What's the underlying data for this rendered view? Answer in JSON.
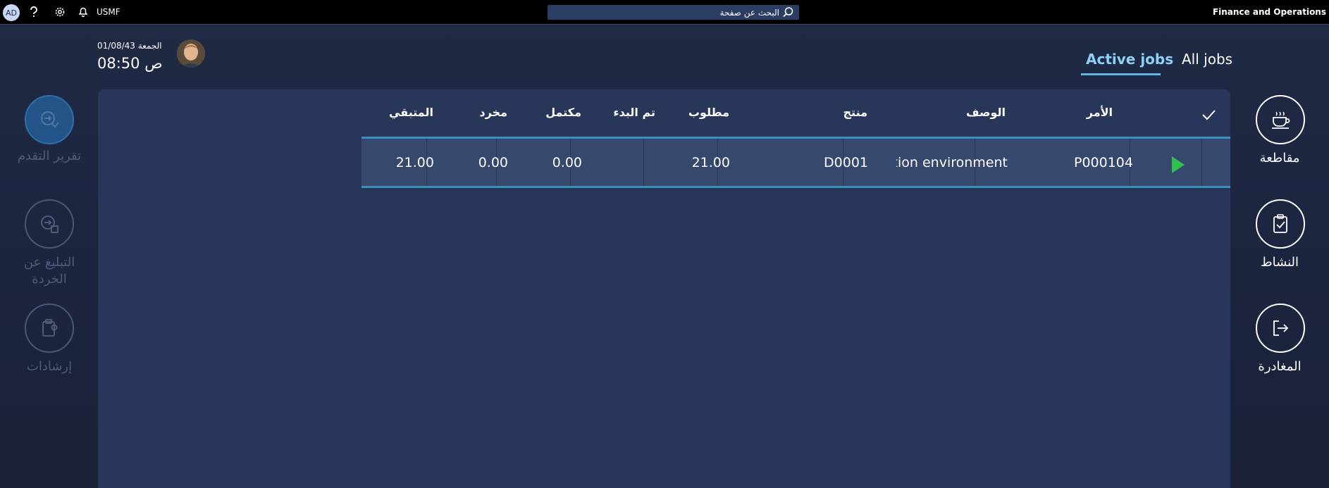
{
  "topbar": {
    "user_initials": "AD",
    "company": "USMF",
    "search_placeholder": "البحث عن صفحة",
    "app_title": "Finance and Operations"
  },
  "header": {
    "date": "الجمعة 01/08/43",
    "time": "08:50 ص"
  },
  "tabs": [
    {
      "label": "Active jobs",
      "active": true
    },
    {
      "label": "All jobs",
      "active": false
    }
  ],
  "table": {
    "headers": {
      "order": "الأمر",
      "description": "الوصف",
      "product": "منتج",
      "required": "مطلوب",
      "started": "تم البدء",
      "completed": "مكتمل",
      "scrapped": "مخرد",
      "remaining": "المتبقي"
    },
    "rows": [
      {
        "order": "P000104",
        "description": "tion environment...",
        "product": "D0001",
        "required": "21.00",
        "started": "",
        "completed": "0.00",
        "scrapped": "0.00",
        "remaining": "21.00"
      }
    ]
  },
  "right_actions": [
    {
      "label": "مقاطعة",
      "icon": "coffee-cup-icon"
    },
    {
      "label": "النشاط",
      "icon": "clipboard-check-icon"
    },
    {
      "label": "المغادرة",
      "icon": "sign-out-icon"
    }
  ],
  "left_actions": [
    {
      "label": "تقرير التقدم",
      "icon": "report-progress-icon"
    },
    {
      "label_line1": "التبليغ عن",
      "label_line2": "الخردة",
      "icon": "report-scrap-icon"
    },
    {
      "label": "إرشادات",
      "icon": "instructions-icon"
    }
  ],
  "colors": {
    "accent": "#8fd0f5",
    "play": "#2ec24a",
    "panel": "#283659",
    "row": "#37486e"
  }
}
